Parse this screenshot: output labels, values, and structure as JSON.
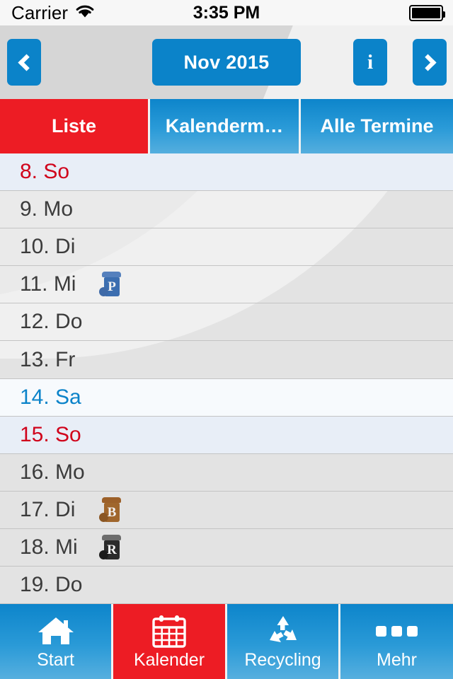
{
  "status_bar": {
    "carrier": "Carrier",
    "wifi_icon": "wifi-icon",
    "time": "3:35 PM",
    "battery_icon": "battery-full-icon"
  },
  "header": {
    "prev_icon": "chevron-left-icon",
    "month_label": "Nov 2015",
    "info_label": "i",
    "next_icon": "chevron-right-icon",
    "accent_blue": "#0b83c9",
    "background": "#d6d6d6"
  },
  "segments": {
    "items": [
      {
        "label": "Liste",
        "active": true,
        "color": "#ed1c24"
      },
      {
        "label": "Kalenderm…",
        "active": false,
        "color": "#2b9bd8"
      },
      {
        "label": "Alle Termine",
        "active": false,
        "color": "#2b9bd8"
      }
    ]
  },
  "list": {
    "rows": [
      {
        "day": "8. So",
        "kind": "sunday",
        "icons": []
      },
      {
        "day": "9. Mo",
        "kind": "weekday",
        "icons": []
      },
      {
        "day": "10. Di",
        "kind": "weekday",
        "icons": []
      },
      {
        "day": "11. Mi",
        "kind": "weekday",
        "icons": [
          {
            "name": "bin-paper-icon",
            "letter": "P",
            "color": "#3c6eb0",
            "lid": "#5580bd",
            "wheel": "#3f6aa8"
          }
        ]
      },
      {
        "day": "12. Do",
        "kind": "weekday",
        "icons": []
      },
      {
        "day": "13. Fr",
        "kind": "weekday",
        "icons": []
      },
      {
        "day": "14. Sa",
        "kind": "saturday",
        "icons": []
      },
      {
        "day": "15. So",
        "kind": "sunday",
        "icons": []
      },
      {
        "day": "16. Mo",
        "kind": "weekday",
        "icons": []
      },
      {
        "day": "17. Di",
        "kind": "weekday",
        "icons": [
          {
            "name": "bin-bio-icon",
            "letter": "B",
            "color": "#a0662c",
            "lid": "#9c6029",
            "wheel": "#8a5623"
          }
        ]
      },
      {
        "day": "18. Mi",
        "kind": "weekday",
        "icons": [
          {
            "name": "bin-residual-icon",
            "letter": "R",
            "color": "#2b2b2b",
            "lid": "#6d6d6d",
            "wheel": "#1b1b1b"
          }
        ]
      },
      {
        "day": "19. Do",
        "kind": "weekday",
        "icons": []
      }
    ],
    "colors": {
      "sunday_text": "#d0021b",
      "saturday_text": "#0b83c9",
      "weekday_text": "#3b3b3b",
      "sunday_bg": "#e8eef7",
      "saturday_bg": "#f7fafd",
      "row_separator": "#c4c4c4"
    }
  },
  "tabbar": {
    "items": [
      {
        "label": "Start",
        "icon": "home-icon",
        "active": false,
        "color": "#2a9ad7"
      },
      {
        "label": "Kalender",
        "icon": "calendar-icon",
        "active": true,
        "color": "#ed1c24"
      },
      {
        "label": "Recycling",
        "icon": "recycle-icon",
        "active": false,
        "color": "#2a9ad7"
      },
      {
        "label": "Mehr",
        "icon": "ellipsis-icon",
        "active": false,
        "color": "#2a9ad7"
      }
    ]
  }
}
